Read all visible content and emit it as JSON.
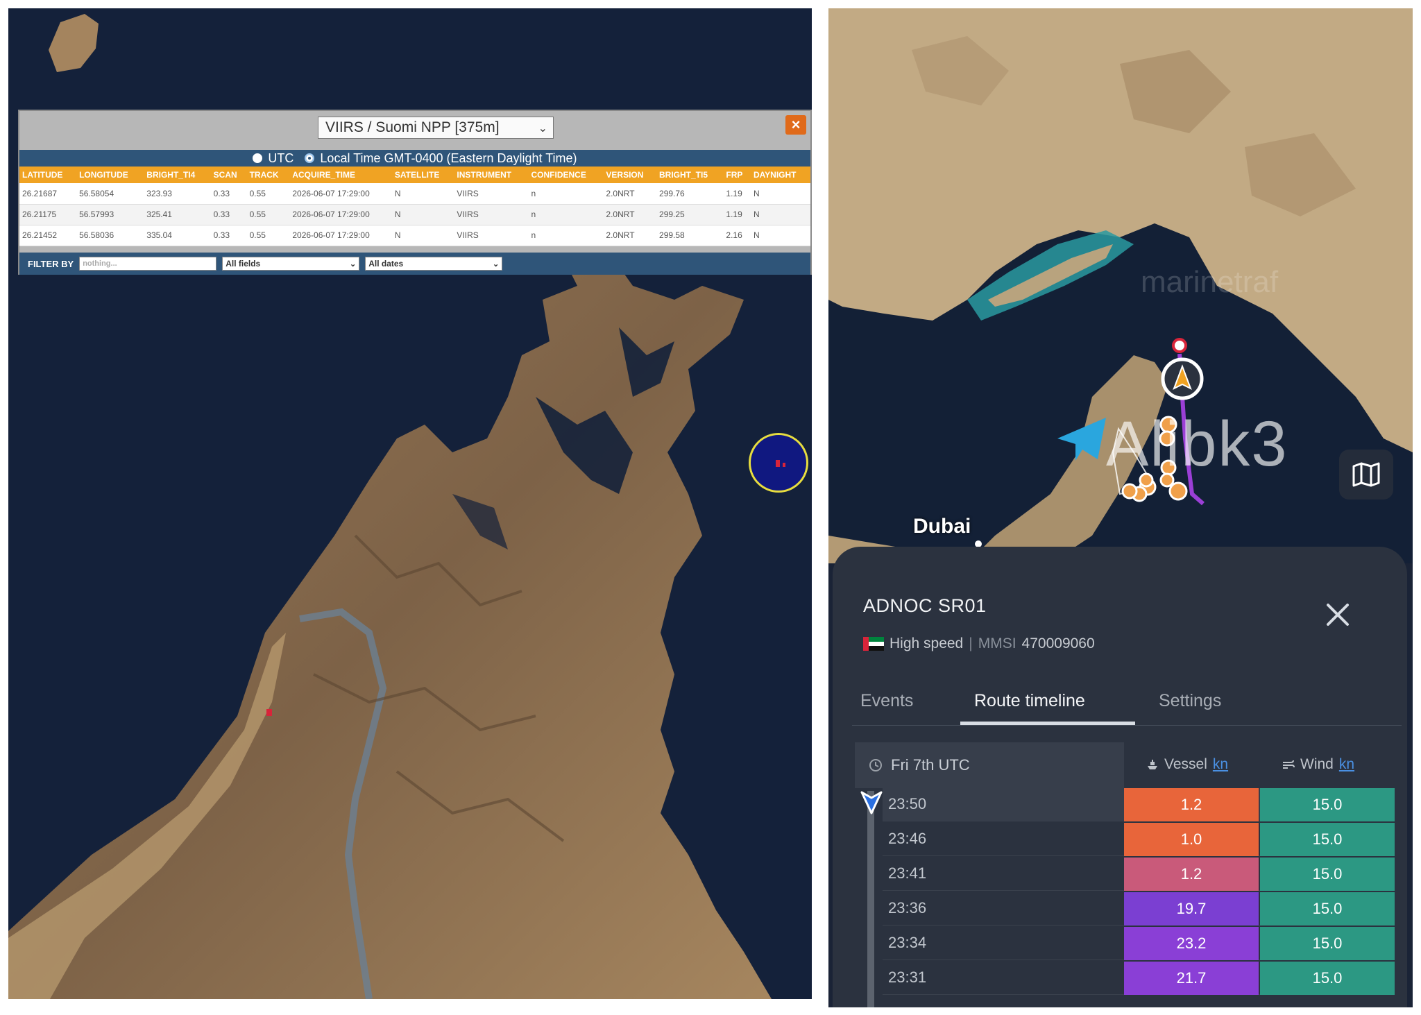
{
  "firms": {
    "satellite_select": "VIIRS / Suomi NPP [375m]",
    "close_label": "×",
    "time_utc_label": "UTC",
    "time_local_label": "Local Time GMT-0400 (Eastern Daylight Time)",
    "columns": [
      "LATITUDE",
      "LONGITUDE",
      "BRIGHT_TI4",
      "SCAN",
      "TRACK",
      "ACQUIRE_TIME",
      "SATELLITE",
      "INSTRUMENT",
      "CONFIDENCE",
      "VERSION",
      "BRIGHT_TI5",
      "FRP",
      "DAYNIGHT"
    ],
    "rows": [
      [
        "26.21687",
        "56.58054",
        "323.93",
        "0.33",
        "0.55",
        "2026-06-07 17:29:00",
        "N",
        "VIIRS",
        "n",
        "2.0NRT",
        "299.76",
        "1.19",
        "N"
      ],
      [
        "26.21175",
        "56.57993",
        "325.41",
        "0.33",
        "0.55",
        "2026-06-07 17:29:00",
        "N",
        "VIIRS",
        "n",
        "2.0NRT",
        "299.25",
        "1.19",
        "N"
      ],
      [
        "26.21452",
        "56.58036",
        "335.04",
        "0.33",
        "0.55",
        "2026-06-07 17:29:00",
        "N",
        "VIIRS",
        "n",
        "2.0NRT",
        "299.58",
        "2.16",
        "N"
      ]
    ],
    "filter_label": "FILTER BY",
    "filter_placeholder": "nothing...",
    "field_select": "All fields",
    "date_select": "All dates"
  },
  "right_map": {
    "city_label": "Dubai",
    "watermark": "Alibk3",
    "brand_watermark": "marinetraf"
  },
  "vessel": {
    "name": "ADNOC SR01",
    "status": "High speed",
    "mmsi_label": "MMSI",
    "mmsi": "470009060",
    "close_label": "close",
    "tabs": [
      {
        "label": "Events",
        "active": false
      },
      {
        "label": "Route timeline",
        "active": true
      },
      {
        "label": "Settings",
        "active": false
      }
    ],
    "timeline": {
      "date_header": "Fri 7th UTC",
      "vessel_header": "Vessel",
      "wind_header": "Wind",
      "unit": "kn",
      "rows": [
        {
          "time": "23:50",
          "vessel": "1.2",
          "wind": "15.0",
          "vessel_color": "#e8653a",
          "selected": true
        },
        {
          "time": "23:46",
          "vessel": "1.0",
          "wind": "15.0",
          "vessel_color": "#e8653a",
          "selected": false
        },
        {
          "time": "23:41",
          "vessel": "1.2",
          "wind": "15.0",
          "vessel_color": "#c95a7a",
          "selected": false
        },
        {
          "time": "23:36",
          "vessel": "19.7",
          "wind": "15.0",
          "vessel_color": "#7b3fd2",
          "selected": false
        },
        {
          "time": "23:34",
          "vessel": "23.2",
          "wind": "15.0",
          "vessel_color": "#8a3fd6",
          "selected": false
        },
        {
          "time": "23:31",
          "vessel": "21.7",
          "wind": "15.0",
          "vessel_color": "#8a3fd6",
          "selected": false
        }
      ]
    }
  },
  "colors": {
    "table_header": "#f0a323",
    "popup_band": "#2f5579",
    "speed_low": "#e8653a",
    "speed_high": "#8a3fd6",
    "wind": "#2c9883"
  },
  "icons": [
    "close-icon",
    "radio-icon",
    "hotspot-circle",
    "telegram-icon",
    "vessel-arrow-icon",
    "map-layers-icon",
    "flag-uae-icon",
    "clock-icon",
    "ship-icon",
    "wind-icon",
    "timeline-marker-icon"
  ]
}
